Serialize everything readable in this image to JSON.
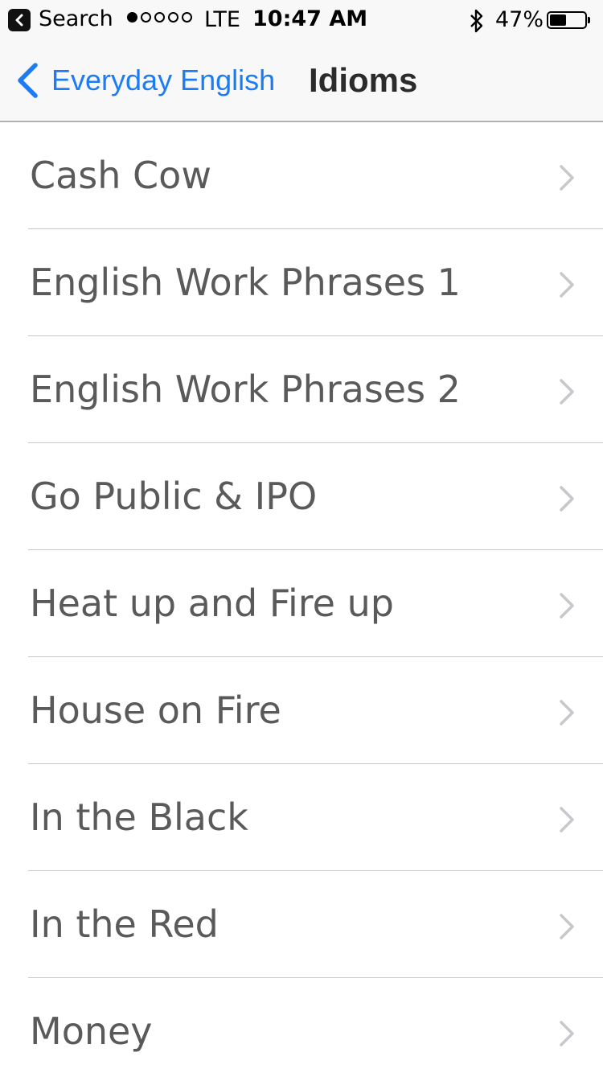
{
  "status_bar": {
    "back_app_label": "Search",
    "signal_filled": 1,
    "signal_total": 5,
    "carrier": "LTE",
    "time": "10:47 AM",
    "bluetooth_icon": "bluetooth-icon",
    "battery_percent_text": "47%",
    "battery_level": 0.47
  },
  "nav": {
    "back_label": "Everyday English",
    "back_icon": "chevron-left-icon",
    "title": "Idioms",
    "accent_color": "#1d7cf2"
  },
  "list": {
    "chevron_icon": "chevron-right-icon",
    "items": [
      {
        "label": "Cash Cow"
      },
      {
        "label": "English Work Phrases 1"
      },
      {
        "label": "English Work Phrases 2"
      },
      {
        "label": "Go Public & IPO"
      },
      {
        "label": "Heat up and Fire up"
      },
      {
        "label": "House on Fire"
      },
      {
        "label": "In the Black"
      },
      {
        "label": "In the Red"
      },
      {
        "label": "Money"
      }
    ]
  }
}
